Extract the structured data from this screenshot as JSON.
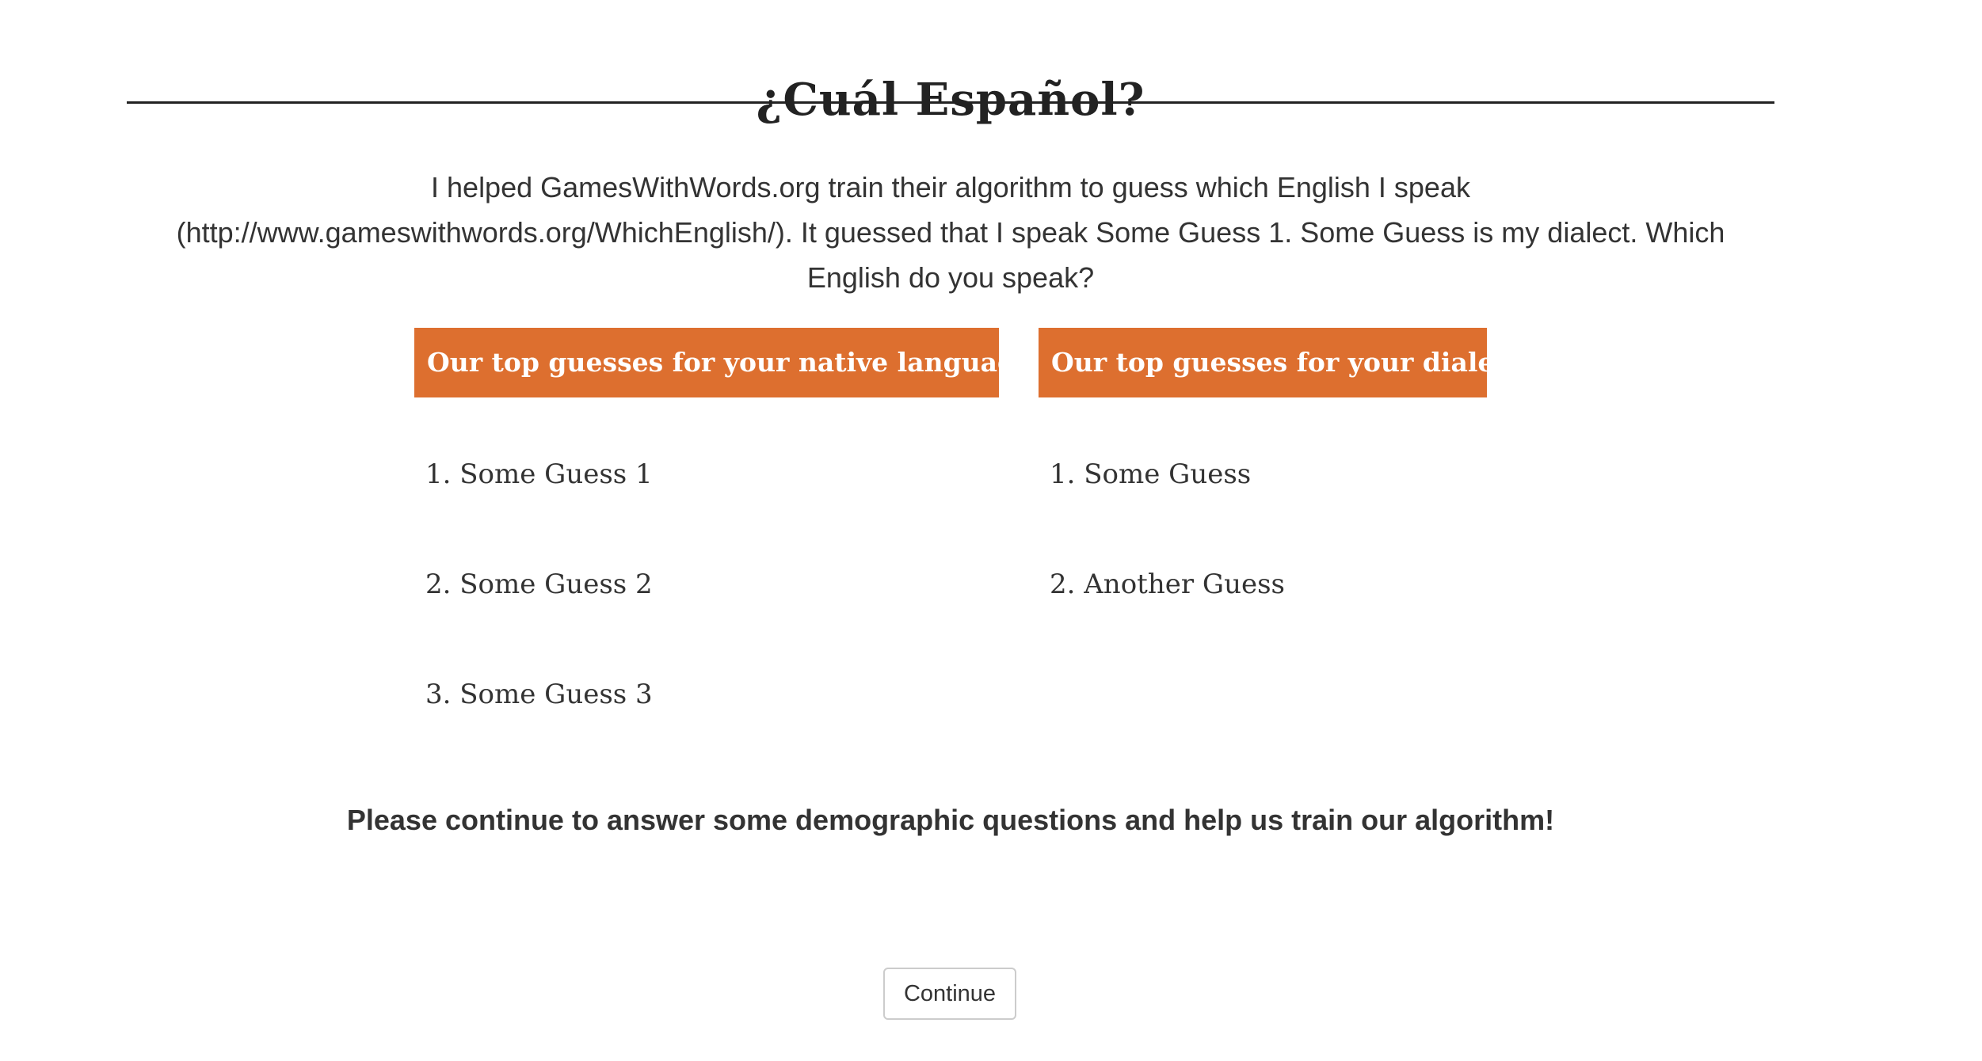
{
  "page": {
    "title": "¿Cuál Español?",
    "intro": "I helped GamesWithWords.org train their algorithm to guess which English I speak (http://www.gameswithwords.org/WhichEnglish/). It guessed that I speak Some Guess 1. Some Guess is my dialect. Which English do you speak?"
  },
  "native_language": {
    "header": "Our top guesses for your native language:",
    "items": [
      "1. Some Guess 1",
      "2. Some Guess 2",
      "3. Some Guess 3"
    ]
  },
  "dialect": {
    "header": "Our top guesses for your dialect:",
    "items": [
      "1. Some Guess",
      "2. Another Guess"
    ]
  },
  "cta": {
    "text": "Please continue to answer some demographic questions and help us train our algorithm!",
    "continue_label": "Continue"
  },
  "colors": {
    "accent": "#dd6f2f",
    "text": "#333333",
    "rule": "#222222"
  }
}
